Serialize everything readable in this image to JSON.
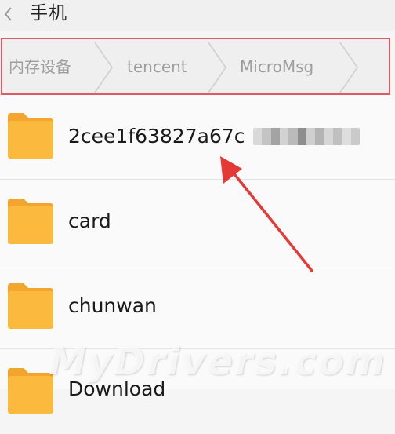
{
  "header": {
    "title": "手机"
  },
  "breadcrumb": {
    "items": [
      {
        "label": "内存设备"
      },
      {
        "label": "tencent"
      },
      {
        "label": "MicroMsg"
      }
    ]
  },
  "files": [
    {
      "name": "2cee1f63827a67c",
      "icon": "folder-icon",
      "name_partially_redacted": true
    },
    {
      "name": "card",
      "icon": "folder-icon"
    },
    {
      "name": "chunwan",
      "icon": "folder-icon"
    },
    {
      "name": "Download",
      "icon": "folder-icon"
    }
  ],
  "annotation": {
    "arrow_color": "#e53935",
    "highlight_color": "#e05a63"
  },
  "watermark": {
    "text": "MyDrivers.com"
  },
  "colors": {
    "folder": "#fbb93d",
    "folder_tab": "#f3a52e",
    "background": "#f5f5f5"
  }
}
